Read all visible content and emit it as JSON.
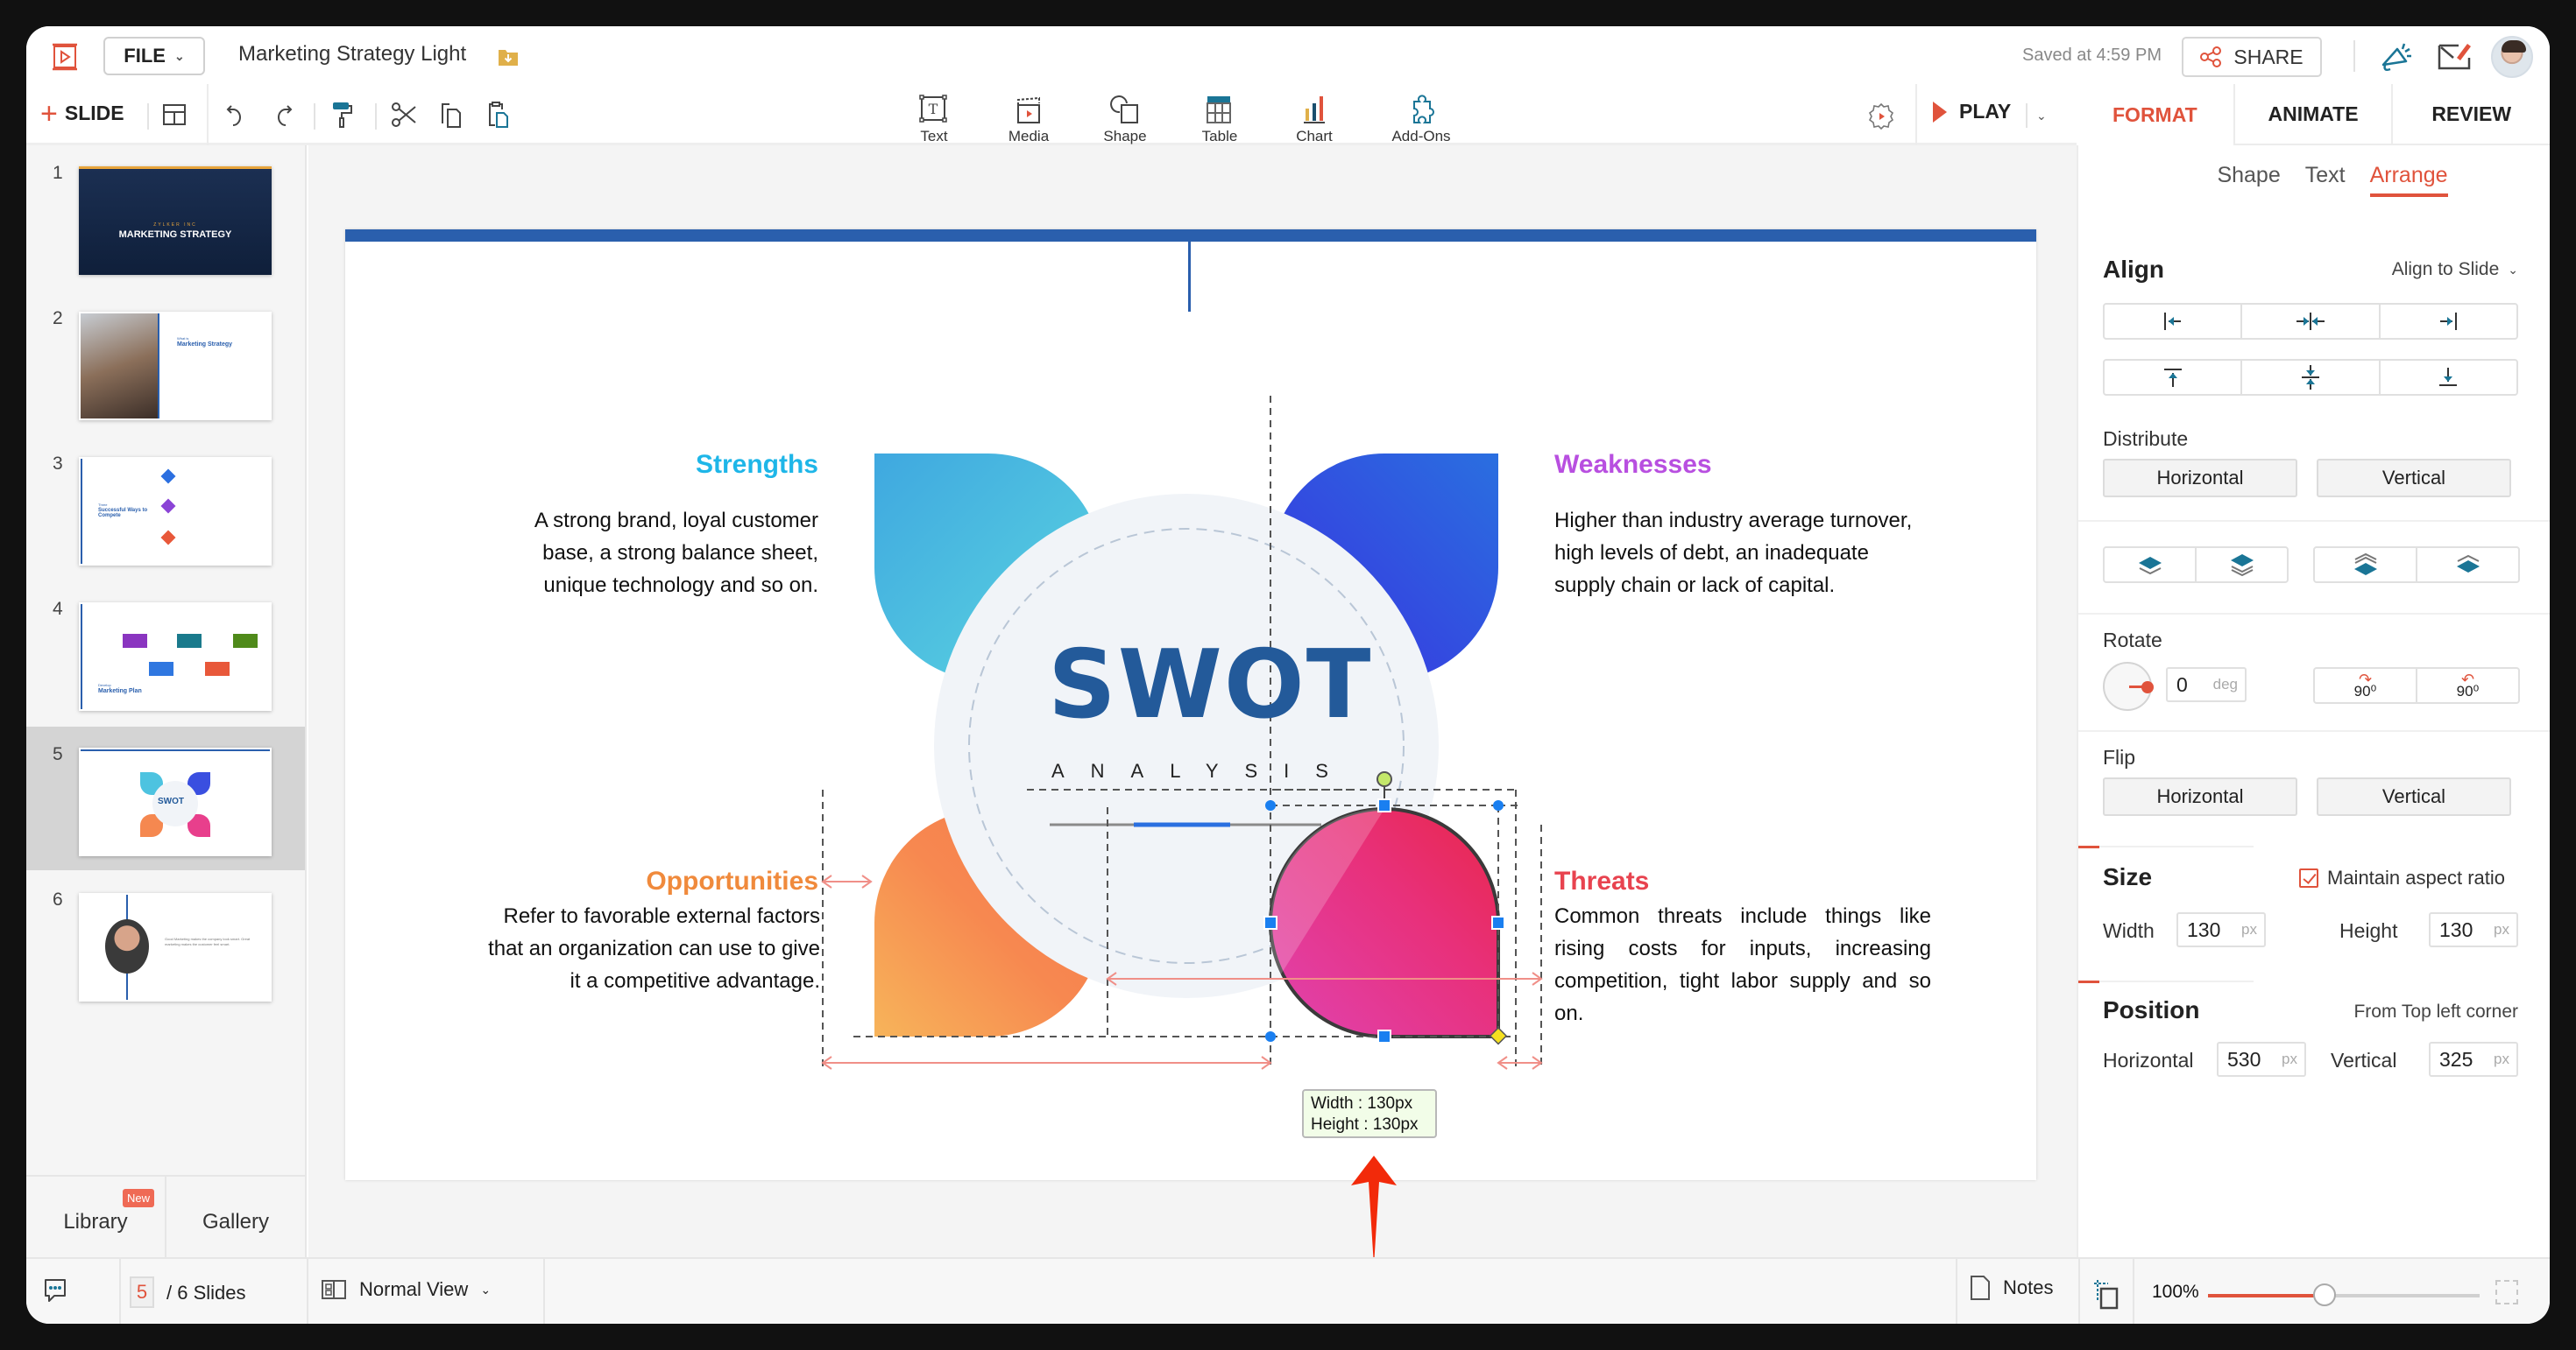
{
  "app": {
    "file_menu": "FILE",
    "doc_title": "Marketing Strategy Light",
    "saved_status": "Saved at 4:59 PM",
    "share_label": "SHARE"
  },
  "toolbar": {
    "add_slide": "SLIDE",
    "insert_items": [
      {
        "label": "Text",
        "icon": "text-box-icon"
      },
      {
        "label": "Media",
        "icon": "media-clapper-icon"
      },
      {
        "label": "Shape",
        "icon": "shape-icon"
      },
      {
        "label": "Table",
        "icon": "table-icon"
      },
      {
        "label": "Chart",
        "icon": "chart-icon"
      },
      {
        "label": "Add-Ons",
        "icon": "puzzle-icon"
      }
    ],
    "play_label": "PLAY"
  },
  "right_tabs": [
    "FORMAT",
    "ANIMATE",
    "REVIEW"
  ],
  "right_tabs_active": "FORMAT",
  "sub_tabs": [
    "Shape",
    "Text",
    "Arrange"
  ],
  "sub_tabs_active": "Arrange",
  "arrange": {
    "align_title": "Align",
    "align_to": "Align to Slide",
    "distribute_label": "Distribute",
    "distribute_buttons": [
      "Horizontal",
      "Vertical"
    ],
    "rotate_label": "Rotate",
    "rotate_value": "0",
    "rotate_unit": "deg",
    "rotate_cw": "90⁰",
    "rotate_ccw": "90⁰",
    "flip_label": "Flip",
    "flip_buttons": [
      "Horizontal",
      "Vertical"
    ],
    "size_title": "Size",
    "maintain_aspect": "Maintain aspect ratio",
    "maintain_aspect_checked": true,
    "width_label": "Width",
    "width_value": "130",
    "height_label": "Height",
    "height_value": "130",
    "unit_px": "px",
    "position_title": "Position",
    "position_ref": "From Top left corner",
    "horizontal_label": "Horizontal",
    "horizontal_value": "530",
    "vertical_label": "Vertical",
    "vertical_value": "325"
  },
  "slides_panel": {
    "slides": [
      {
        "num": "1",
        "title": "MARKETING STRATEGY",
        "subtitle": "ZYLKER INC"
      },
      {
        "num": "2",
        "title": "Marketing Strategy",
        "subtitle": "What is"
      },
      {
        "num": "3",
        "title": "Successful Ways to Compete",
        "subtitle": "Three"
      },
      {
        "num": "4",
        "title": "Marketing Plan",
        "subtitle": "Develop"
      },
      {
        "num": "5",
        "title": "SWOT",
        "subtitle": "ANALYSIS"
      },
      {
        "num": "6",
        "title": "Good Marketing makes the company look smart. Great marketing makes the customer feel smart.",
        "subtitle": ""
      }
    ],
    "active_slide": "5",
    "library_label": "Library",
    "library_badge": "New",
    "gallery_label": "Gallery"
  },
  "slide": {
    "swot_title": "SWOT",
    "swot_subtitle": "ANALYSIS",
    "strengths": {
      "title": "Strengths",
      "body": "A strong  brand, loyal  customer base, a strong  balance  sheet, unique  technology  and so on.",
      "color": "#1eb6e8"
    },
    "weaknesses": {
      "title": "Weaknesses",
      "body": "Higher  than industry  average turnover, high levels of debt, an inadequate  supply  chain or lack of capital.",
      "color": "#b84fe0"
    },
    "opportunities": {
      "title": "Opportunities",
      "body": "Refer  to favorable  external factors  that an organization  can use to give it a competitive advantage.",
      "color": "#f08a3c"
    },
    "threats": {
      "title": "Threats",
      "body": "Common  threats  include  things  like rising  costs  for inputs,  increasing competition,  tight  labor  supply  and so on.",
      "color": "#e8434f"
    },
    "size_tooltip": {
      "width": "Width : 130px",
      "height": "Height : 130px"
    }
  },
  "statusbar": {
    "current_slide": "5",
    "total_slides": "/ 6 Slides",
    "view_mode": "Normal View",
    "notes_label": "Notes",
    "zoom_level": "100%",
    "zoom_fraction": 0.43
  },
  "colors": {
    "accent": "#e0533c",
    "brand_blue": "#2a5fad",
    "icon_teal": "#1a7596"
  }
}
